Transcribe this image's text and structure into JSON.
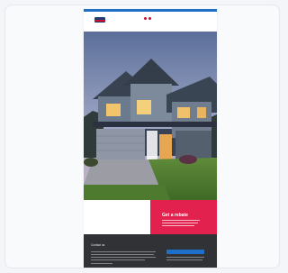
{
  "top_bar": {
    "links": [
      "",
      "",
      ""
    ]
  },
  "nav": {
    "links": [
      "",
      "",
      ""
    ]
  },
  "promo": {
    "title": "Get a rebate"
  },
  "footer": {
    "title": "Contact us",
    "button_label": ""
  },
  "colors": {
    "brand_blue": "#1e6fc8",
    "brand_red": "#c8102e",
    "promo_pink": "#e3214f",
    "footer_dark": "#303236"
  }
}
